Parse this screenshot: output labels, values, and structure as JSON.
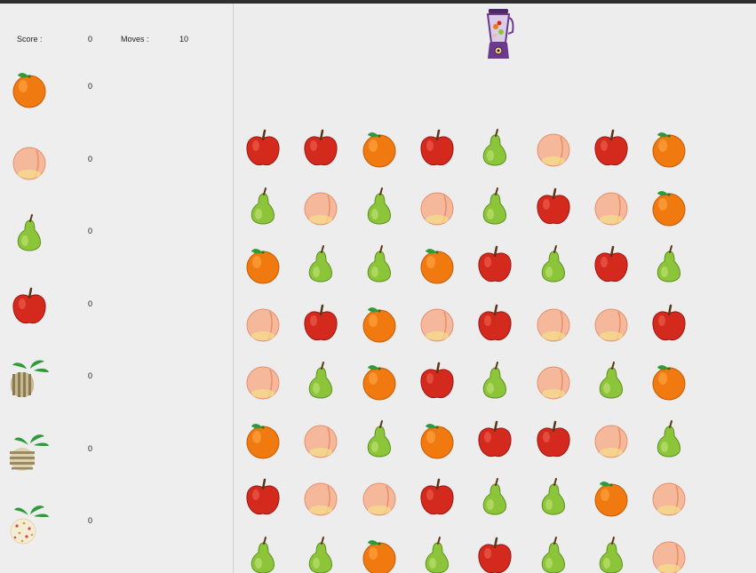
{
  "hud": {
    "score_label": "Score :",
    "score_value": "0",
    "moves_label": "Moves :",
    "moves_value": "10"
  },
  "goals": [
    {
      "fruit": "orange-icon",
      "count": "0"
    },
    {
      "fruit": "peach-icon",
      "count": "0"
    },
    {
      "fruit": "pear-icon",
      "count": "0"
    },
    {
      "fruit": "apple-icon",
      "count": "0"
    },
    {
      "fruit": "striped-bush-icon",
      "count": "0"
    },
    {
      "fruit": "banded-bush-icon",
      "count": "0"
    },
    {
      "fruit": "spotted-bush-icon",
      "count": "0"
    }
  ],
  "blender": {
    "icon": "blender-icon"
  },
  "board": {
    "rows": [
      [
        "apple",
        "apple",
        "orange",
        "apple",
        "pear",
        "peach",
        "apple",
        "orange"
      ],
      [
        "pear",
        "peach",
        "pear",
        "peach",
        "pear",
        "apple",
        "peach",
        "orange"
      ],
      [
        "orange",
        "pear",
        "pear",
        "orange",
        "apple",
        "pear",
        "apple",
        "pear"
      ],
      [
        "peach",
        "apple",
        "orange",
        "peach",
        "apple",
        "peach",
        "peach",
        "apple"
      ],
      [
        "peach",
        "pear",
        "orange",
        "apple",
        "pear",
        "peach",
        "pear",
        "orange"
      ],
      [
        "orange",
        "peach",
        "pear",
        "orange",
        "apple",
        "apple",
        "peach",
        "pear"
      ],
      [
        "apple",
        "peach",
        "peach",
        "apple",
        "pear",
        "pear",
        "orange",
        "peach"
      ],
      [
        "pear",
        "pear",
        "orange",
        "pear",
        "apple",
        "pear",
        "pear",
        "peach"
      ]
    ]
  },
  "colors": {
    "background": "#ededed",
    "apple": "#d42a1e",
    "orange": "#f07a10",
    "pear": "#8cc43a",
    "peach": "#f6b89a",
    "leaf": "#2f9a3a",
    "blender": "#6b3a8e"
  }
}
